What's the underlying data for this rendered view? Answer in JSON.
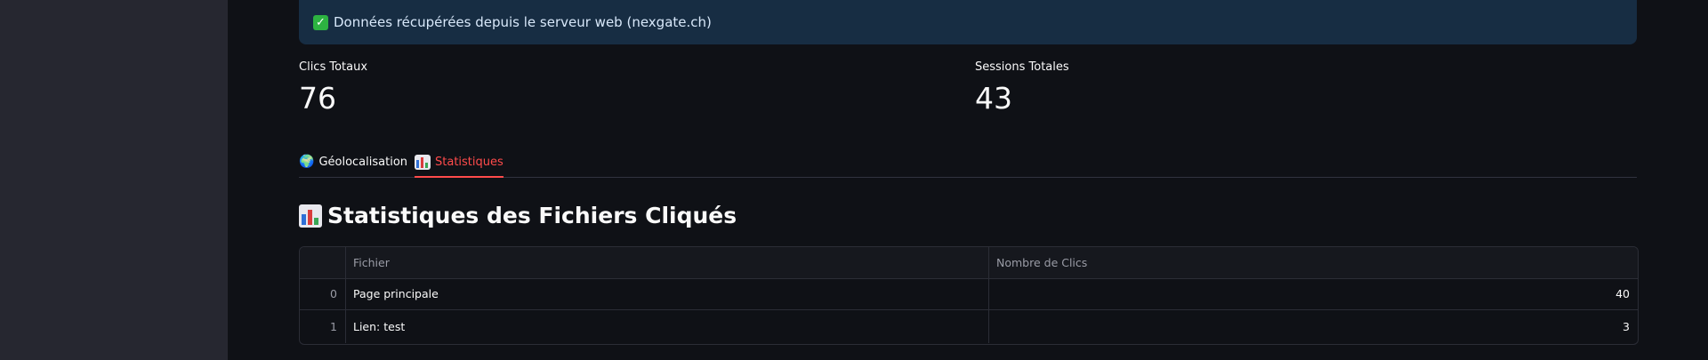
{
  "alert": {
    "icon": "check-mark-icon",
    "text": "Données récupérées depuis le serveur web (nexgate.ch)"
  },
  "metrics": [
    {
      "label": "Clics Totaux",
      "value": "76"
    },
    {
      "label": "Sessions Totales",
      "value": "43"
    }
  ],
  "tabs": [
    {
      "icon": "globe-icon",
      "label": "Géolocalisation",
      "active": false
    },
    {
      "icon": "bar-chart-icon",
      "label": "Statistiques",
      "active": true
    }
  ],
  "section": {
    "icon": "bar-chart-icon",
    "title": "Statistiques des Fichiers Cliqués"
  },
  "table": {
    "columns": [
      "",
      "Fichier",
      "Nombre de Clics"
    ],
    "rows": [
      {
        "index": "0",
        "file": "Page principale",
        "clicks": "40"
      },
      {
        "index": "1",
        "file": "Lien: test",
        "clicks": "3"
      }
    ]
  },
  "colors": {
    "accent": "#ff4b4b",
    "background": "#0f1116",
    "sidebar": "#262730",
    "alert_bg": "#172d43"
  }
}
